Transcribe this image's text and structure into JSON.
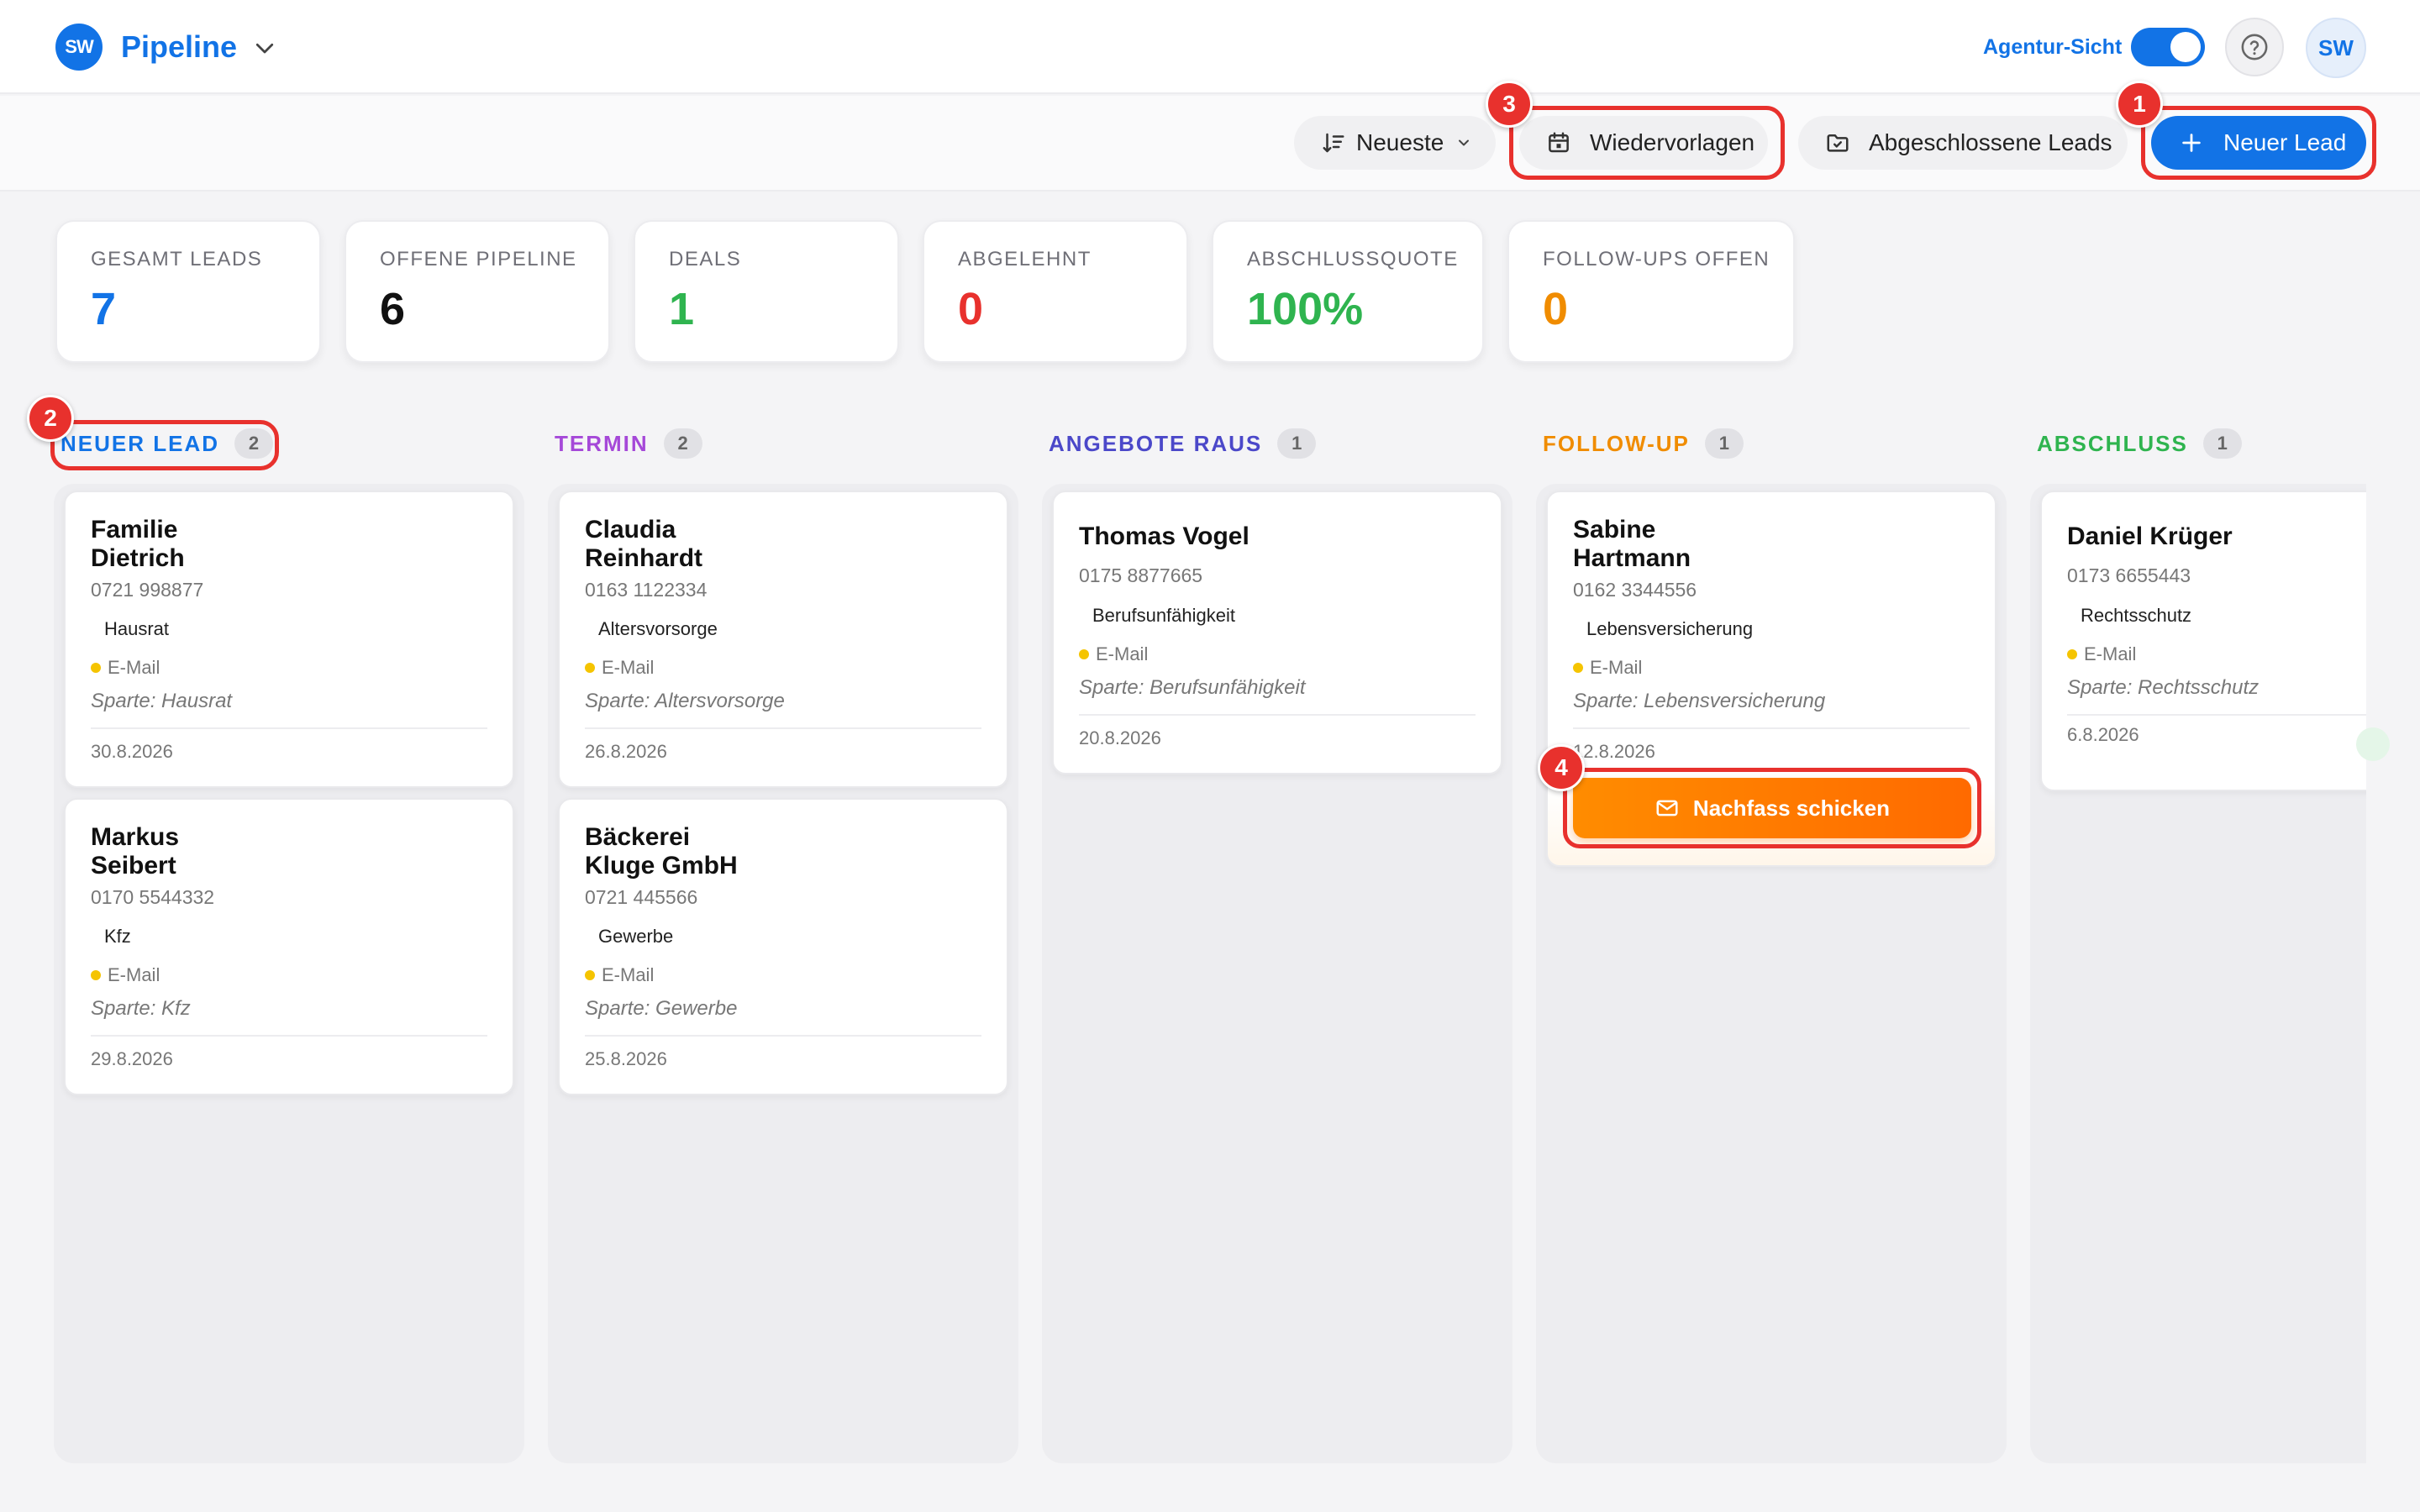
{
  "header": {
    "logo": "SW",
    "title": "Pipeline",
    "agentur_label": "Agentur-Sicht",
    "avatar": "SW",
    "accent": "#1273e6"
  },
  "toolbar": {
    "sort_label": "Neueste",
    "wiedervorlagen_label": "Wiedervorlagen",
    "abgeschlossene_label": "Abgeschlossene Leads",
    "new_lead_label": "Neuer Lead"
  },
  "stats": [
    {
      "label": "GESAMT LEADS",
      "value": "7",
      "color": "#1273e6"
    },
    {
      "label": "OFFENE PIPELINE",
      "value": "6",
      "color": "#111111"
    },
    {
      "label": "DEALS",
      "value": "1",
      "color": "#2fb44f"
    },
    {
      "label": "ABGELEHNT",
      "value": "0",
      "color": "#e8312d"
    },
    {
      "label": "ABSCHLUSSQUOTE",
      "value": "100%",
      "color": "#2fb44f"
    },
    {
      "label": "FOLLOW-UPS OFFEN",
      "value": "0",
      "color": "#f08c00"
    }
  ],
  "columns": [
    {
      "title": "NEUER LEAD",
      "count": "2",
      "color": "#1273e6",
      "cards": [
        {
          "name": "Familie Dietrich",
          "phone": "0721 998877",
          "tag": "Hausrat",
          "source": "E-Mail",
          "sparte": "Sparte: Hausrat",
          "date": "30.8.2026"
        },
        {
          "name": "Markus Seibert",
          "phone": "0170 5544332",
          "tag": "Kfz",
          "source": "E-Mail",
          "sparte": "Sparte: Kfz",
          "date": "29.8.2026"
        }
      ]
    },
    {
      "title": "TERMIN",
      "count": "2",
      "color": "#a548d8",
      "cards": [
        {
          "name": "Claudia Reinhardt",
          "phone": "0163 1122334",
          "tag": "Altersvorsorge",
          "source": "E-Mail",
          "sparte": "Sparte: Altersvorsorge",
          "date": "26.8.2026"
        },
        {
          "name": "Bäckerei Kluge GmbH",
          "phone": "0721 445566",
          "tag": "Gewerbe",
          "source": "E-Mail",
          "sparte": "Sparte: Gewerbe",
          "date": "25.8.2026"
        }
      ]
    },
    {
      "title": "ANGEBOTE RAUS",
      "count": "1",
      "color": "#4b48c9",
      "cards": [
        {
          "name": "Thomas Vogel",
          "phone": "0175 8877665",
          "tag": "Berufsunfähigkeit",
          "source": "E-Mail",
          "sparte": "Sparte: Berufsunfähigkeit",
          "date": "20.8.2026"
        }
      ]
    },
    {
      "title": "FOLLOW-UP",
      "count": "1",
      "color": "#f08c00",
      "cards": [
        {
          "name": "Sabine Hartmann",
          "phone": "0162 3344556",
          "tag": "Lebensversicherung",
          "source": "E-Mail",
          "sparte": "Sparte: Lebensversicherung",
          "date": "12.8.2026",
          "action": "Nachfass schicken"
        }
      ]
    },
    {
      "title": "ABSCHLUSS",
      "count": "1",
      "color": "#2fb44f",
      "cards": [
        {
          "name": "Daniel Krüger",
          "phone": "0173 6655443",
          "tag": "Rechtsschutz",
          "source": "E-Mail",
          "sparte": "Sparte: Rechtsschutz",
          "date": "6.8.2026"
        }
      ]
    }
  ],
  "card_name_lines": {
    "c0_0": [
      "Familie",
      "Dietrich"
    ],
    "c0_1": [
      "Markus",
      "Seibert"
    ],
    "c1_0": [
      "Claudia",
      "Reinhardt"
    ],
    "c1_1": [
      "Bäckerei",
      "Kluge GmbH"
    ],
    "c3_0": [
      "Sabine",
      "Hartmann"
    ]
  },
  "annotations": [
    "1",
    "2",
    "3",
    "4"
  ]
}
